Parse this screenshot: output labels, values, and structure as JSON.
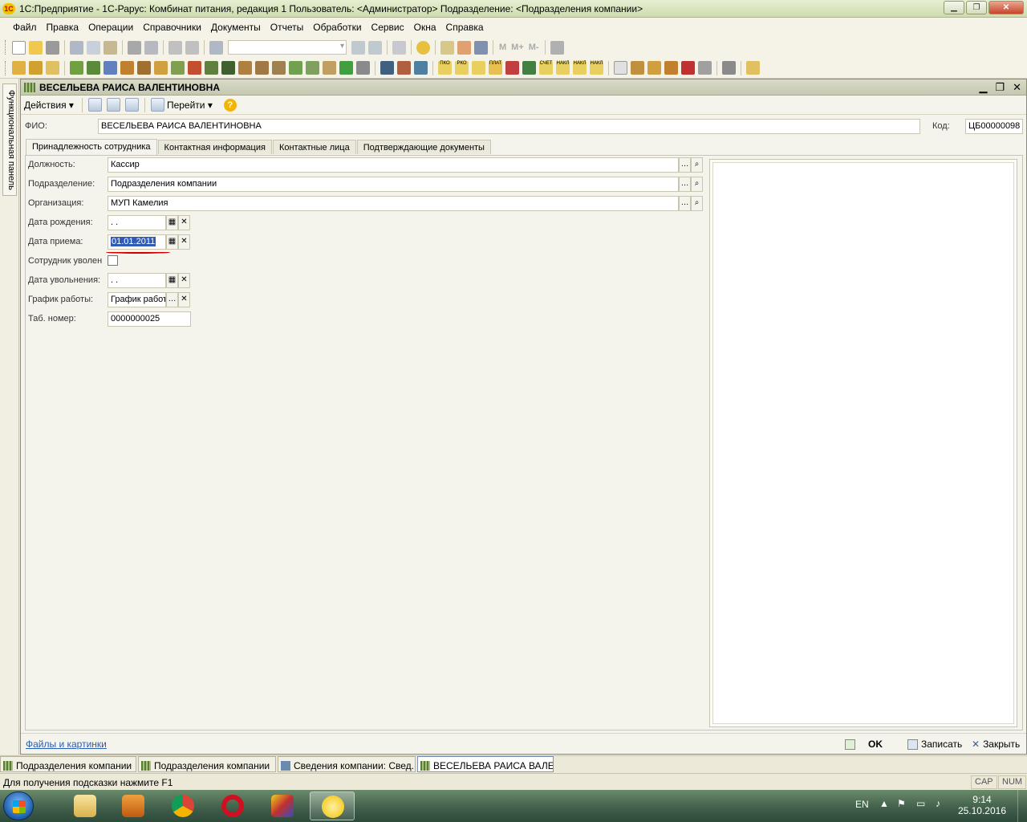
{
  "window": {
    "app_icon": "1c-logo-icon",
    "title": "1С:Предприятие - 1С-Рарус: Комбинат питания, редакция 1    Пользователь: <Администратор>    Подразделение: <Подразделения компании>",
    "controls": [
      "minimize",
      "maximize",
      "close"
    ]
  },
  "menu": [
    "Файл",
    "Правка",
    "Операции",
    "Справочники",
    "Документы",
    "Отчеты",
    "Обработки",
    "Сервис",
    "Окна",
    "Справка"
  ],
  "toolbar1": {
    "icons": [
      "new-icon",
      "open-icon",
      "save-icon",
      "cut-icon",
      "copy-icon",
      "paste-icon",
      "print-icon",
      "preview-icon",
      "undo-icon",
      "redo-icon",
      "find-icon",
      "search-combo",
      "find-next-icon",
      "find-prev-icon",
      "windows-icon",
      "info-icon",
      "calculator-icon",
      "calendar-icon",
      "users-icon",
      "tools-icon"
    ],
    "memory_buttons": [
      "M",
      "M+",
      "M-"
    ]
  },
  "toolbar2": {
    "icons": [
      "arm-icon",
      "zak-icon",
      "report-icon",
      "catalog-icon",
      "warehouse-icon",
      "goods-icon",
      "menu-icon",
      "recipe-icon",
      "staff-icon",
      "person-icon",
      "money-icon",
      "kitchen-icon",
      "book-icon",
      "team-icon",
      "persons-icon",
      "group-icon",
      "tree-icon",
      "network-icon",
      "box-icon",
      "plus-icon",
      "list-icon",
      "chart-icon",
      "chart2-icon"
    ],
    "labeled": [
      "ПКО",
      "РКО",
      "ПЛАТ",
      "СЧЕТ",
      "НАКЛ",
      "НАКЛ",
      "НАКЛ"
    ]
  },
  "side_panel": {
    "label": "Функциональная панель"
  },
  "document": {
    "title": "ВЕСЕЛЬЕВА РАИСА ВАЛЕНТИНОВНА",
    "toolbar": {
      "actions_label": "Действия",
      "goto_label": "Перейти"
    },
    "fio_label": "ФИО:",
    "fio_value": "ВЕСЕЛЬЕВА РАИСА ВАЛЕНТИНОВНА",
    "code_label": "Код:",
    "code_value": "ЦБ00000098",
    "tabs": [
      "Принадлежность сотрудника",
      "Контактная информация",
      "Контактные лица",
      "Подтверждающие документы"
    ],
    "fields": {
      "position_label": "Должность:",
      "position_value": "Кассир",
      "department_label": "Подразделение:",
      "department_value": "Подразделения компании",
      "organization_label": "Организация:",
      "organization_value": "МУП Камелия",
      "birth_date_label": "Дата рождения:",
      "birth_date_value": " .  .",
      "hire_date_label": "Дата приема:",
      "hire_date_value": "01.01.2011",
      "dismissed_label": "Сотрудник уволен",
      "dismiss_date_label": "Дата увольнения:",
      "dismiss_date_value": " .  .",
      "schedule_label": "График работы:",
      "schedule_value": "График работ",
      "tab_number_label": "Таб. номер:",
      "tab_number_value": "0000000025"
    },
    "footer": {
      "files_link": "Файлы и картинки",
      "ok": "OK",
      "save": "Записать",
      "close": "Закрыть"
    }
  },
  "window_tabs": [
    "Подразделения компании",
    "Подразделения компании",
    "Сведения компании: Свед...:",
    "ВЕСЕЛЬЕВА РАИСА ВАЛЕ..."
  ],
  "status": {
    "hint": "Для получения подсказки нажмите F1",
    "cap": "CAP",
    "num": "NUM"
  },
  "taskbar": {
    "apps": [
      "explorer",
      "media-player",
      "chrome",
      "opera",
      "1c-launcher",
      "1c-enterprise"
    ],
    "lang": "EN",
    "time": "9:14",
    "date": "25.10.2016"
  },
  "colors": {
    "titlebar": "#cfdcae",
    "selection": "#2f5bb7",
    "annotation": "#d40000",
    "link": "#2a5db0"
  }
}
